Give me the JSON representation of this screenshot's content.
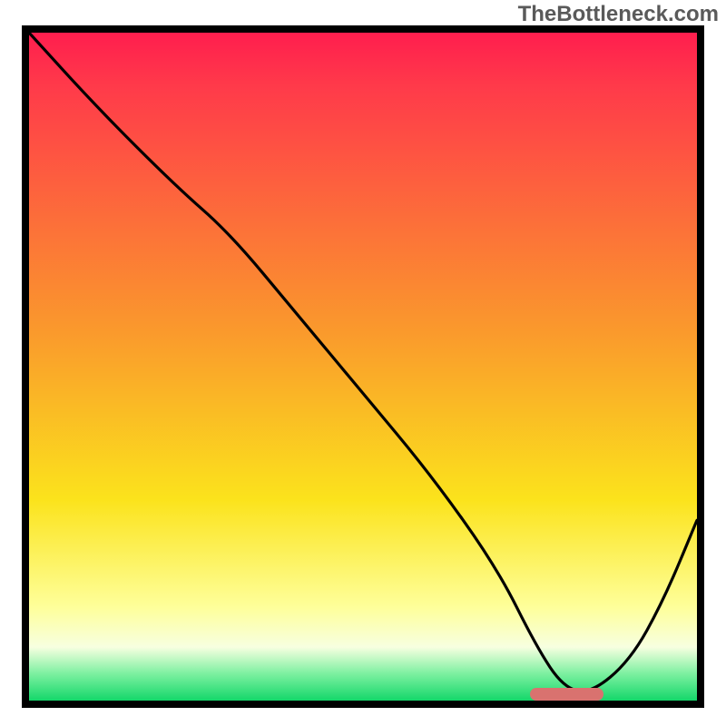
{
  "attribution": "TheBottleneck.com",
  "colors": {
    "top": "#ff1e4e",
    "redpink": "#ff3a4a",
    "orange": "#fa9a2c",
    "yellow": "#fbe31c",
    "paleyellow": "#feff9a",
    "whitish": "#f7ffe0",
    "lightgreen": "#7cf0a0",
    "green": "#14d76a",
    "marker": "#d9726f"
  },
  "chart_data": {
    "type": "line",
    "title": "",
    "xlabel": "",
    "ylabel": "",
    "xlim": [
      0,
      100
    ],
    "ylim": [
      0,
      100
    ],
    "grid": false,
    "legend": false,
    "series": [
      {
        "name": "bottleneck-curve",
        "x": [
          0,
          10,
          22,
          30,
          40,
          50,
          60,
          70,
          76,
          80,
          84,
          90,
          95,
          100
        ],
        "y": [
          100,
          89,
          77,
          70,
          58,
          46,
          34,
          20,
          8,
          2,
          1,
          6,
          15,
          27
        ]
      }
    ],
    "annotations": [
      {
        "name": "optimal-range-marker",
        "type": "hbar",
        "y": 1,
        "x_start": 75,
        "x_end": 86
      }
    ]
  }
}
